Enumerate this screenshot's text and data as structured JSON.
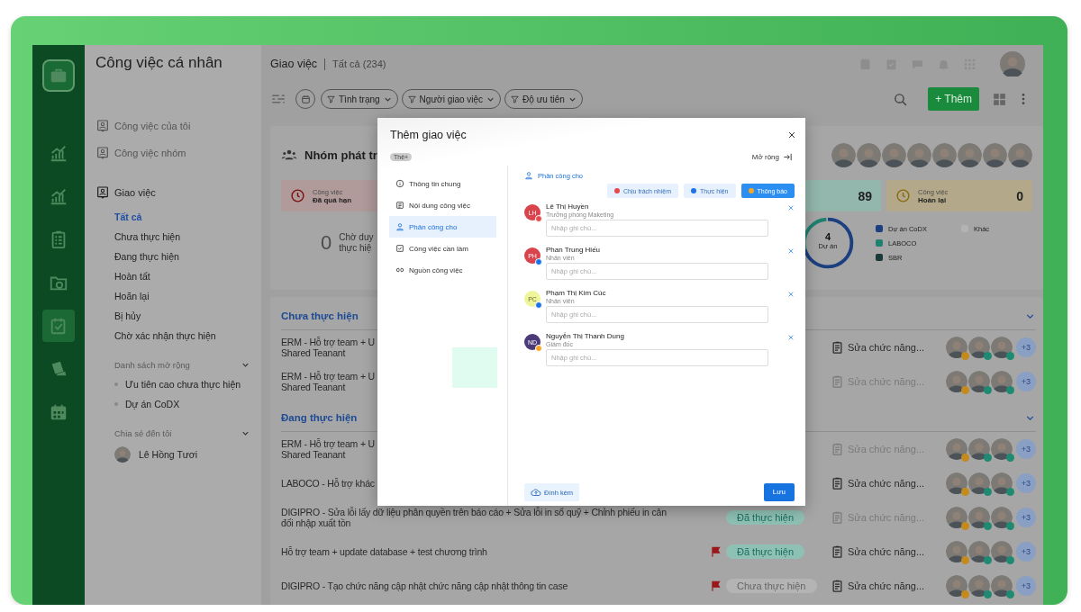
{
  "rail": {
    "items": [
      {
        "kind": "logo",
        "selected": false
      },
      {
        "kind": "chart",
        "selected": false
      },
      {
        "kind": "chart",
        "selected": false
      },
      {
        "kind": "checklist",
        "selected": false
      },
      {
        "kind": "folder",
        "selected": false
      },
      {
        "kind": "task",
        "selected": true
      },
      {
        "kind": "tickets",
        "selected": false
      },
      {
        "kind": "calendar",
        "selected": false
      }
    ]
  },
  "sidebar": {
    "title": "Công việc cá nhân",
    "links": [
      {
        "label": "Công việc của tôi"
      },
      {
        "label": "Công việc nhóm"
      }
    ],
    "group": {
      "label": "Giao việc",
      "items": [
        {
          "label": "Tất cả",
          "selected": true
        },
        {
          "label": "Chưa thực hiện",
          "selected": false
        },
        {
          "label": "Đang thực hiện",
          "selected": false
        },
        {
          "label": "Hoàn tất",
          "selected": false
        },
        {
          "label": "Hoãn lại",
          "selected": false
        },
        {
          "label": "Bị hủy",
          "selected": false
        },
        {
          "label": "Chờ xác nhận thực hiện",
          "selected": false
        }
      ]
    },
    "extended": {
      "title": "Danh sách mở rộng",
      "expanded": true,
      "items": [
        {
          "label": "Ưu tiên cao chưa thực hiện"
        },
        {
          "label": "Dự án CoDX"
        }
      ]
    },
    "shared": {
      "title": "Chia sẻ đến tôi",
      "expanded": true,
      "people": [
        {
          "name": "Lê Hồng Tươi"
        }
      ]
    }
  },
  "header": {
    "title": "Giao việc",
    "subtitle": "Tất cả (234)"
  },
  "filters": [
    {
      "label": "Tình trạng"
    },
    {
      "label": "Người giao việc"
    },
    {
      "label": "Độ ưu tiên"
    }
  ],
  "add_button": {
    "label": "+ Thêm"
  },
  "summary": {
    "title": "Nhóm phát tr",
    "stats": [
      {
        "kind": "overdue",
        "label": "Công việc",
        "status": "Đã quá hạn"
      },
      {
        "kind": "done",
        "value": "89"
      },
      {
        "kind": "returned",
        "label": "Công việc",
        "status": "Hoàn lại",
        "value": "0"
      }
    ],
    "pending": {
      "value": "0",
      "label": "Chờ duy\nthực hiệ"
    },
    "donut": {
      "value": "4",
      "label": "Dự án"
    },
    "legend": [
      {
        "label": "Dự án CoDX",
        "color": "#1c3f80"
      },
      {
        "label": "LABOCO",
        "color": "#1f8070"
      },
      {
        "label": "SBR",
        "color": "#1a3a3a"
      },
      {
        "label": "Khác",
        "color": "#b3b3b3"
      }
    ]
  },
  "groups": [
    {
      "title": "Chưa thực hiện",
      "expanded": true,
      "tasks": [
        {
          "title": "ERM - Hỗ trợ team + U\nShared Teanant",
          "flagged": false,
          "subtask": "Sửa chức năng...",
          "muted": false,
          "more": "+3",
          "assignees": [
            {
              "color": "#c48a1c"
            },
            {
              "color": "#1f8a72"
            },
            {
              "color": "#1f8a72"
            }
          ]
        },
        {
          "title": "ERM - Hỗ trợ team + U\nShared Teanant",
          "flagged": false,
          "subtask": "Sửa chức năng...",
          "muted": true,
          "more": "+3",
          "assignees": [
            {
              "color": "#c48a1c"
            },
            {
              "color": "#1f8a72"
            },
            {
              "color": "#1f8a72"
            }
          ]
        }
      ]
    },
    {
      "title": "Đang thực hiện",
      "expanded": true,
      "tasks": [
        {
          "title": "ERM - Hỗ trợ team + U\nShared Teanant",
          "flagged": false,
          "subtask": "Sửa chức năng...",
          "muted": true,
          "more": "+3",
          "assignees": [
            {
              "color": "#c48a1c"
            },
            {
              "color": "#1f8a72"
            },
            {
              "color": "#1f8a72"
            }
          ]
        },
        {
          "title": "LABOCO - Hỗ trợ khác",
          "flagged": false,
          "subtask": "Sửa chức năng...",
          "muted": false,
          "more": "+3",
          "assignees": [
            {
              "color": "#c48a1c"
            },
            {
              "color": "#1f8a72"
            },
            {
              "color": "#1f8a72"
            }
          ]
        },
        {
          "title": "DIGIPRO - Sửa lỗi lấy dữ liệu phân quyền trên báo cáo + Sửa lỗi in sổ quỹ + Chỉnh phiếu in cân\nđối nhập xuất tồn",
          "flagged": false,
          "status": {
            "label": "Đã thực hiện",
            "kind": "done"
          },
          "subtask": "Sửa chức năng...",
          "muted": true,
          "more": "+3",
          "assignees": [
            {
              "color": "#c48a1c"
            },
            {
              "color": "#1f8a72"
            },
            {
              "color": "#1f8a72"
            }
          ]
        },
        {
          "title": "Hỗ trợ team + update database + test chương trình",
          "flagged": true,
          "status": {
            "label": "Đã thực hiện",
            "kind": "done"
          },
          "subtask": "Sửa chức năng...",
          "muted": false,
          "more": "+3",
          "assignees": [
            {
              "color": "#c48a1c"
            },
            {
              "color": "#1f8a72"
            },
            {
              "color": "#1f8a72"
            }
          ]
        },
        {
          "title": "DIGIPRO - Tạo chức năng cập nhật chức năng cập nhật thông tin case",
          "flagged": true,
          "status": {
            "label": "Chưa thực hiện",
            "kind": "todo"
          },
          "subtask": "Sửa chức năng...",
          "muted": false,
          "more": "+3",
          "assignees": [
            {
              "color": "#c48a1c"
            },
            {
              "color": "#1f8a72"
            },
            {
              "color": "#1f8a72"
            }
          ]
        }
      ]
    }
  ],
  "modal": {
    "title": "Thêm giao việc",
    "tag": "Thê+",
    "expand": "Mở rộng",
    "nav": [
      {
        "label": "Thông tin chung",
        "kind": "info",
        "selected": false
      },
      {
        "label": "Nội dung công việc",
        "kind": "content",
        "selected": false
      },
      {
        "label": "Phân công cho",
        "kind": "assign",
        "selected": true
      },
      {
        "label": "Công việc cần làm",
        "kind": "todo",
        "selected": false
      },
      {
        "label": "Nguồn công việc",
        "kind": "link",
        "selected": false
      }
    ],
    "section_title": "Phân công cho",
    "roles": [
      {
        "label": "Chịu trách nhiệm",
        "kind": "responsible",
        "selected": false
      },
      {
        "label": "Thực hiện",
        "kind": "perform",
        "selected": false
      },
      {
        "label": "Thông báo",
        "kind": "notify",
        "selected": true
      }
    ],
    "assignees": [
      {
        "initials": "LH",
        "name": "Lê Thị Huyền",
        "position": "Trưởng phòng Maketing",
        "placeholder": "Nhập ghi chú...",
        "color": "#d9434b",
        "kind": "responsible"
      },
      {
        "initials": "PH",
        "name": "Phan Trung Hiếu",
        "position": "Nhân viên",
        "placeholder": "Nhập ghi chú...",
        "color": "#d9434b",
        "kind": "perform"
      },
      {
        "initials": "PC",
        "name": "Phạm Thị Kim Cúc",
        "position": "Nhân viên",
        "placeholder": "Nhập ghi chú...",
        "color": "#eef59a",
        "kind": "perform"
      },
      {
        "initials": "ND",
        "name": "Nguyễn Thị Thanh Dung",
        "position": "Giám đốc",
        "placeholder": "Nhập ghi chú...",
        "color": "#4b3a78",
        "kind": "notify"
      }
    ],
    "attach": "Đính kèm",
    "save": "Lưu"
  }
}
